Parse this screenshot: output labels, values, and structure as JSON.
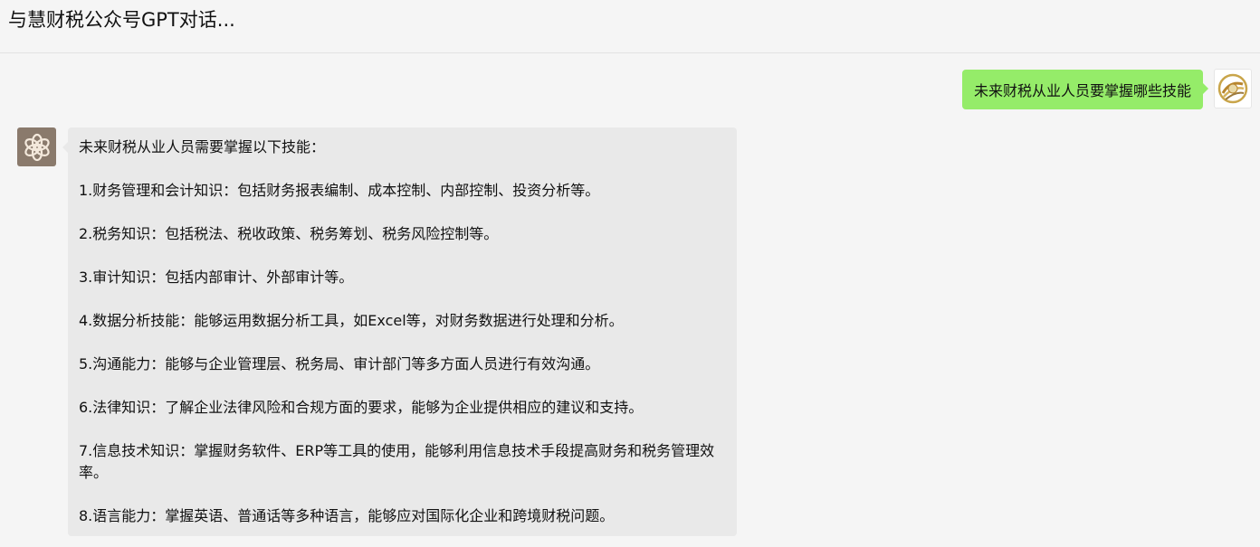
{
  "header": {
    "title": "与慧财税公众号GPT对话..."
  },
  "user_message": {
    "text": "未来财税从业人员要掌握哪些技能",
    "avatar_icon": "gold-swirl-logo-icon"
  },
  "bot_message": {
    "avatar_icon": "openai-logo-icon",
    "intro": "未来财税从业人员需要掌握以下技能：",
    "items": [
      "1.财务管理和会计知识：包括财务报表编制、成本控制、内部控制、投资分析等。",
      "2.税务知识：包括税法、税收政策、税务筹划、税务风险控制等。",
      "3.审计知识：包括内部审计、外部审计等。",
      "4.数据分析技能：能够运用数据分析工具，如Excel等，对财务数据进行处理和分析。",
      "5.沟通能力：能够与企业管理层、税务局、审计部门等多方面人员进行有效沟通。",
      "6.法律知识：了解企业法律风险和合规方面的要求，能够为企业提供相应的建议和支持。",
      "7.信息技术知识：掌握财务软件、ERP等工具的使用，能够利用信息技术手段提高财务和税务管理效率。",
      "8.语言能力：掌握英语、普通话等多种语言，能够应对国际化企业和跨境财税问题。"
    ]
  },
  "colors": {
    "user_bubble": "#95ec69",
    "bot_bubble": "#e9e9e9",
    "background": "#f5f5f5"
  }
}
